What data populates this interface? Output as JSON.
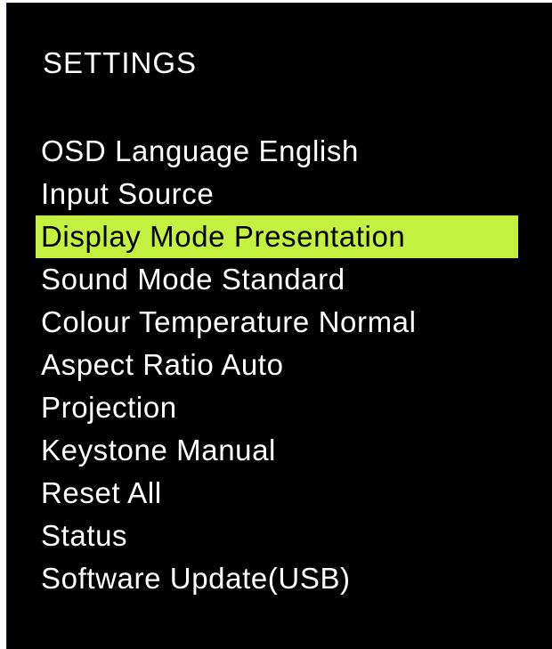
{
  "menu": {
    "title": "SETTINGS",
    "selected_index": 2,
    "highlight_color": "#c4f040",
    "items": [
      {
        "label": "OSD Language  English"
      },
      {
        "label": "Input Source"
      },
      {
        "label": "Display Mode  Presentation"
      },
      {
        "label": "Sound Mode  Standard"
      },
      {
        "label": "Colour Temperature  Normal"
      },
      {
        "label": "Aspect Ratio Auto"
      },
      {
        "label": "Projection"
      },
      {
        "label": "Keystone Manual"
      },
      {
        "label": "Reset All"
      },
      {
        "label": "Status"
      },
      {
        "label": "Software Update(USB)"
      }
    ]
  }
}
